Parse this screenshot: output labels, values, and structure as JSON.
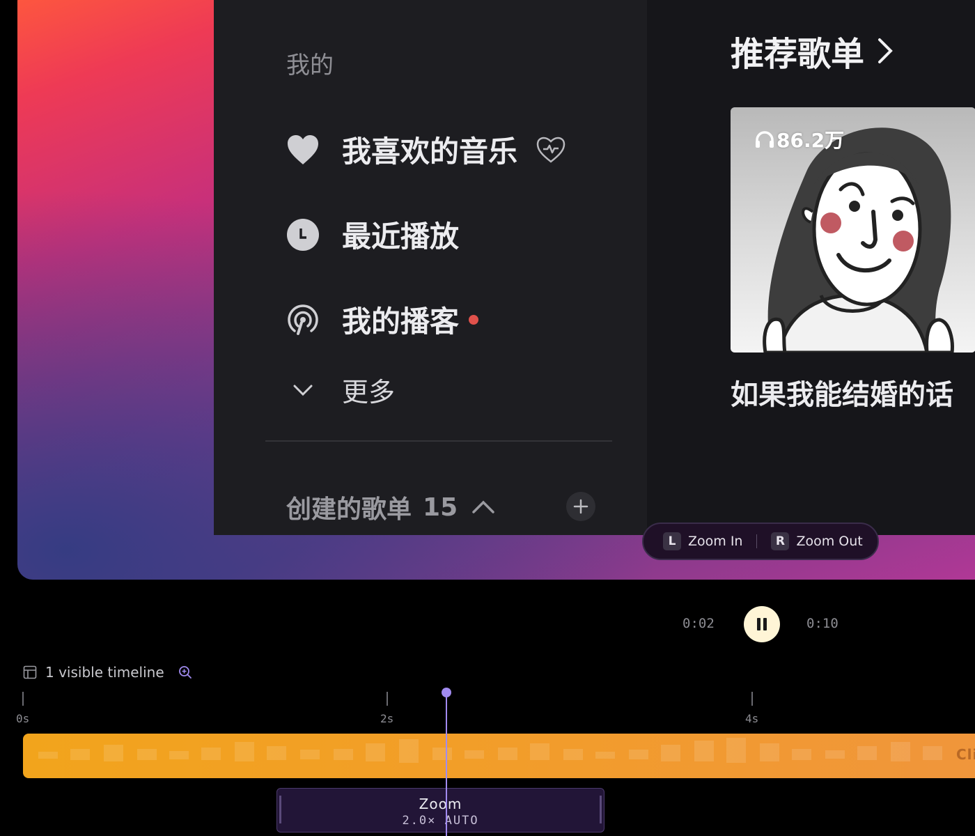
{
  "preview": {
    "sidebar": {
      "section_label": "我的",
      "items": [
        {
          "label": "我喜欢的音乐",
          "icon": "heart-icon"
        },
        {
          "label": "最近播放",
          "icon": "clock-icon"
        },
        {
          "label": "我的播客",
          "icon": "podcast-icon"
        },
        {
          "label": "更多",
          "icon": "chevron-down-icon"
        }
      ],
      "created_playlists_label": "创建的歌单",
      "created_playlists_count": "15"
    },
    "content": {
      "section_title": "推荐歌单",
      "playlist": {
        "play_count": "86.2万",
        "name": "如果我能结婚的话"
      }
    },
    "zoom_hint": {
      "left_key": "L",
      "left_label": "Zoom In",
      "right_key": "R",
      "right_label": "Zoom Out"
    }
  },
  "transport": {
    "current_time": "0:02",
    "total_time": "0:10",
    "state": "playing"
  },
  "timeline": {
    "header_label": "1 visible timeline",
    "ticks": [
      "0s",
      "2s",
      "4s"
    ],
    "clip_label": "Cli",
    "zoom_segment": {
      "title": "Zoom",
      "subtitle": "2.0× AUTO"
    }
  },
  "colors": {
    "accent": "#a18bf0",
    "clip": "#f2a41c",
    "notification_dot": "#e0514b",
    "pause_button": "#fff5d6"
  }
}
